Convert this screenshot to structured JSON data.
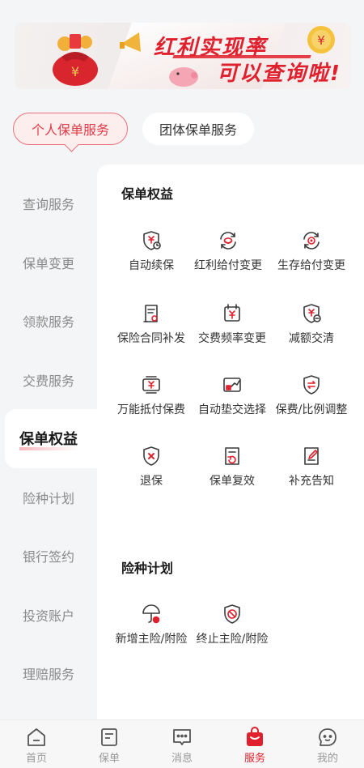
{
  "banner": {
    "line1": "红利实现率",
    "line2": "可以查询啦!",
    "coin_symbol": "¥",
    "bag_symbol": "¥"
  },
  "tabs": [
    {
      "label": "个人保单服务",
      "active": true
    },
    {
      "label": "团体保单服务",
      "active": false
    }
  ],
  "sidebar": {
    "items": [
      {
        "label": "查询服务"
      },
      {
        "label": "保单变更"
      },
      {
        "label": "领款服务"
      },
      {
        "label": "交费服务"
      },
      {
        "label": "保单权益",
        "active": true
      },
      {
        "label": "险种计划"
      },
      {
        "label": "银行签约"
      },
      {
        "label": "投资账户"
      },
      {
        "label": "理赔服务"
      }
    ]
  },
  "main": {
    "sections": [
      {
        "title": "保单权益",
        "items": [
          {
            "label": "自动续保",
            "icon": "shield-yen-clock-icon"
          },
          {
            "label": "红利给付变更",
            "icon": "bonus-refresh-icon"
          },
          {
            "label": "生存给付变更",
            "icon": "survival-refresh-icon"
          },
          {
            "label": "保险合同补发",
            "icon": "contract-reissue-icon"
          },
          {
            "label": "交费频率变更",
            "icon": "calendar-yen-icon"
          },
          {
            "label": "减额交清",
            "icon": "shield-yen-minus-icon"
          },
          {
            "label": "万能抵付保费",
            "icon": "wallet-offset-icon"
          },
          {
            "label": "自动垫交选择",
            "icon": "auto-advance-icon"
          },
          {
            "label": "保费/比例调整",
            "icon": "ratio-adjust-icon"
          },
          {
            "label": "退保",
            "icon": "shield-cross-icon"
          },
          {
            "label": "保单复效",
            "icon": "document-restore-icon"
          },
          {
            "label": "补充告知",
            "icon": "document-edit-icon"
          }
        ]
      },
      {
        "title": "险种计划",
        "items": [
          {
            "label": "新增主险/附险",
            "icon": "umbrella-add-icon"
          },
          {
            "label": "终止主险/附险",
            "icon": "shield-stop-icon"
          }
        ]
      }
    ]
  },
  "bottom_nav": [
    {
      "label": "首页",
      "icon": "home-icon"
    },
    {
      "label": "保单",
      "icon": "policy-icon"
    },
    {
      "label": "消息",
      "icon": "message-icon"
    },
    {
      "label": "服务",
      "icon": "service-bag-icon",
      "active": true
    },
    {
      "label": "我的",
      "icon": "profile-icon"
    }
  ],
  "colors": {
    "accent": "#e0202c",
    "icon_stroke": "#3a3a3a"
  }
}
